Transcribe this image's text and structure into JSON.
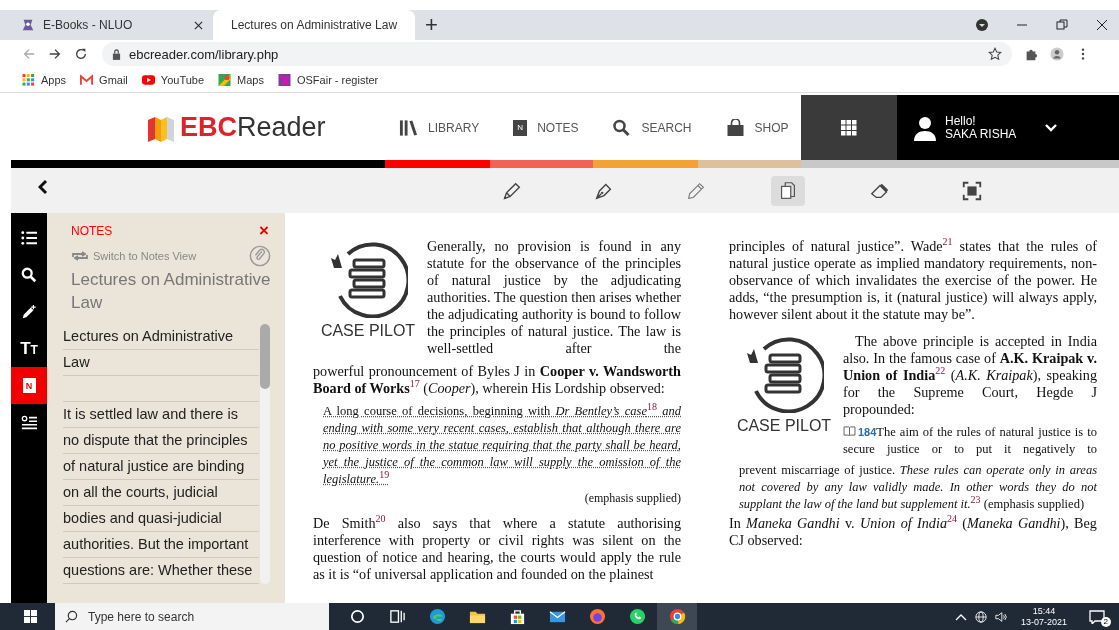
{
  "browser": {
    "tabs": [
      {
        "title": "E-Books - NLUO",
        "kind": "nluo",
        "selected": false
      },
      {
        "title": "Lectures on Administrative Law",
        "kind": "book",
        "selected": true
      }
    ],
    "new_tab": "+",
    "address": "ebcreader.com/library.php",
    "bookmarks": [
      {
        "label": "Apps",
        "kind": "apps"
      },
      {
        "label": "Gmail",
        "kind": "gmail"
      },
      {
        "label": "YouTube",
        "kind": "youtube"
      },
      {
        "label": "Maps",
        "kind": "maps"
      },
      {
        "label": "OSFair - register",
        "kind": "osfair"
      }
    ]
  },
  "header": {
    "logo": {
      "part_1": "EBC",
      "part_2": "Reader"
    },
    "nav": [
      {
        "label": "LIBRARY",
        "kind": "library"
      },
      {
        "label": "NOTES",
        "kind": "notes",
        "badge": "N"
      },
      {
        "label": "SEARCH",
        "kind": "search"
      },
      {
        "label": "SHOP",
        "kind": "shop"
      }
    ],
    "user": {
      "greeting": "Hello!",
      "name": "SAKA RISHA"
    }
  },
  "stripe": [
    {
      "color": "#000000"
    },
    {
      "color": "#ff0000"
    },
    {
      "color": "#f26355"
    },
    {
      "color": "#f3a334"
    },
    {
      "color": "#dcc19c"
    },
    {
      "color": "#c8c8c8"
    }
  ],
  "toolbar": {
    "tools": [
      {
        "kind": "highlighter",
        "selected": false
      },
      {
        "kind": "pen",
        "selected": false
      },
      {
        "kind": "pencil",
        "selected": false
      },
      {
        "kind": "copy",
        "selected": true
      },
      {
        "kind": "eraser",
        "selected": false
      },
      {
        "kind": "fit-screen",
        "selected": false
      }
    ]
  },
  "rail": [
    {
      "kind": "contents",
      "selected": false
    },
    {
      "kind": "search",
      "selected": false
    },
    {
      "kind": "annotate",
      "selected": false
    },
    {
      "kind": "font-size",
      "glyph": "TT",
      "selected": false
    },
    {
      "kind": "notes",
      "badge": "N",
      "selected": true
    },
    {
      "kind": "list",
      "selected": false
    }
  ],
  "notes_panel": {
    "heading": "NOTES",
    "close": "×",
    "switch_link": "Switch to Notes View",
    "title": "Lectures on Administrative Law",
    "title_lines": [
      "Lectures on Administrative",
      "Law"
    ],
    "body_lines": [
      "It is settled law and there is",
      "no dispute that the principles",
      "of natural justice are binding",
      "on all the courts, judicial",
      "bodies and quasi-judicial",
      "authorities. But the important",
      "questions are: Whether these"
    ]
  },
  "book": {
    "columns": [
      [
        {
          "kind": "case_pilot",
          "label": "CASE PILOT",
          "beside": [
            {
              "kind": "para",
              "indent": false,
              "text": "Generally, no provision is found in any statute for the observance of the principles of natural justice by the adjudicating authorities. The question then arises whether the adjudicating authority is bound to follow the principles of natural justice. The law is well-settled after the"
            }
          ]
        },
        {
          "kind": "para",
          "indent": false,
          "text": "powerful pronouncement of Byles J in **Cooper v. Wandsworth Board of Works**$^{17}$ (*Cooper*), wherein His Lordship observed:"
        },
        {
          "kind": "quote",
          "underlined": true,
          "text": "A long course of decisions, beginning with *Dr Bentley’s case*$^{18}$ *and ending with some very recent cases, establish that although there are no positive words in the statue requiring that the party shall be heard, yet the justice of the common law will supply the omission of the legislature.*$^{19}$"
        },
        {
          "kind": "attribution",
          "text": "(emphasis supplied)"
        },
        {
          "kind": "para",
          "indent": false,
          "text": "De Smith$^{20}$ also says that where a statute authorising interference with property or civil rights was silent on the question of notice and hearing, the courts would apply the rule as it is “of universal application and founded on the plainest"
        }
      ],
      [
        {
          "kind": "para",
          "indent": false,
          "text": "principles of natural justice”. Wade$^{21}$ states that the rules of natural justice operate as implied mandatory requirements, non-observance of which invalidates the exercise of the power. He adds, “the presumption is, it (natural justice) will always apply, however silent about it the statute may be”."
        },
        {
          "kind": "case_pilot",
          "label": "CASE PILOT",
          "beside": [
            {
              "kind": "para",
              "indent": true,
              "text": "The above principle is accepted in India also. In the famous case of **A.K. Kraipak v. Union of India**$^{22}$ (*A.K. Kraipak*), speaking for the Supreme Court, Hegde J propounded:"
            },
            {
              "kind": "quote",
              "underlined": false,
              "ref": "184",
              "text": "The aim of the rules of natural justice is to secure justice or to put it negatively to"
            }
          ]
        },
        {
          "kind": "quote",
          "underlined": false,
          "text": "prevent miscarriage of justice. *These rules can operate only in areas not covered by any law validly made. In other words they do not supplant the law of the land but supplement it.*$^{23}$ (emphasis supplied)"
        },
        {
          "kind": "para",
          "indent": false,
          "text": "In *Maneka Gandhi* v. *Union of India*$^{24}$ (*Maneka Gandhi*), Beg CJ observed:"
        }
      ]
    ]
  },
  "taskbar": {
    "search_placeholder": "Type here to search",
    "apps": [
      {
        "kind": "cortana",
        "selected": false
      },
      {
        "kind": "task-view",
        "selected": false
      },
      {
        "kind": "edge",
        "selected": false
      },
      {
        "kind": "explorer",
        "selected": false
      },
      {
        "kind": "store",
        "selected": false
      },
      {
        "kind": "mail",
        "selected": false
      },
      {
        "kind": "firefox",
        "selected": false
      },
      {
        "kind": "whatsapp",
        "selected": false
      },
      {
        "kind": "chrome",
        "selected": true
      }
    ],
    "time": "15:44",
    "date": "13-07-2021",
    "notifications": "2"
  }
}
